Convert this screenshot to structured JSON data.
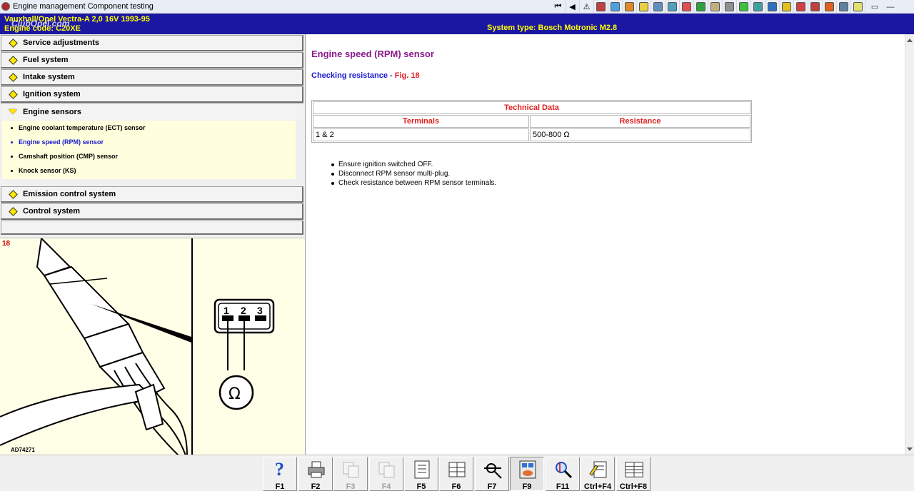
{
  "window": {
    "title": "Engine management Component testing"
  },
  "toolbar_icons": [
    {
      "name": "first-page-icon",
      "glyph": "⏮"
    },
    {
      "name": "previous-icon",
      "glyph": "◀"
    },
    {
      "name": "warning-icon",
      "glyph": "⚠"
    },
    {
      "name": "wiring-icon",
      "color": "#c04040"
    },
    {
      "name": "diagram-icon",
      "color": "#4aa0e0"
    },
    {
      "name": "engine-icon",
      "color": "#e08a2a"
    },
    {
      "name": "camera-icon",
      "color": "#e8d040"
    },
    {
      "name": "wheel-icon",
      "color": "#6090c0"
    },
    {
      "name": "tools-icon",
      "color": "#50a0c0"
    },
    {
      "name": "battery-icon",
      "color": "#e05050"
    },
    {
      "name": "exit-icon",
      "color": "#30a040"
    },
    {
      "name": "brush-icon",
      "color": "#c0b080"
    },
    {
      "name": "spray-icon",
      "color": "#909090"
    },
    {
      "name": "parts-icon",
      "color": "#40c040"
    },
    {
      "name": "gauge-icon",
      "color": "#40a0a0"
    },
    {
      "name": "car-icon",
      "color": "#3070c0"
    },
    {
      "name": "book-icon",
      "color": "#e0c020"
    },
    {
      "name": "doc-icon",
      "color": "#d04040"
    },
    {
      "name": "service-icon",
      "color": "#c04040"
    },
    {
      "name": "alert-icon",
      "color": "#e06020"
    },
    {
      "name": "vehicle-icon",
      "color": "#6080a0"
    },
    {
      "name": "notes-icon",
      "color": "#e0e070"
    }
  ],
  "window_controls": {
    "minimize": "▭",
    "maximize": "—"
  },
  "infobar": {
    "vehicle": "Vauxhall/Opel   Vectra-A  2,0 16V 1993-95",
    "engine": "Engine code: C20XE",
    "system_type": "System type: Bosch Motronic M2.8",
    "watermark": "ClubOpel.com"
  },
  "nav": {
    "sections": [
      {
        "label": "Service adjustments"
      },
      {
        "label": "Fuel system"
      },
      {
        "label": "Intake system"
      },
      {
        "label": "Ignition system"
      }
    ],
    "open_section": {
      "label": "Engine sensors",
      "items": [
        {
          "label": "Engine coolant temperature (ECT) sensor"
        },
        {
          "label": "Engine speed (RPM) sensor"
        },
        {
          "label": "Camshaft position (CMP) sensor"
        },
        {
          "label": "Knock sensor (KS)"
        }
      ]
    },
    "lower_sections": [
      {
        "label": "Emission control system"
      },
      {
        "label": "Control system"
      }
    ]
  },
  "figure": {
    "number": "18",
    "code": "AD74271",
    "pins": [
      "1",
      "2",
      "3"
    ],
    "meter_symbol": "Ω"
  },
  "content": {
    "title": "Engine speed (RPM) sensor",
    "check_label": "Checking resistance",
    "check_sep": " - ",
    "check_fig": "Fig. 18",
    "table": {
      "caption": "Technical Data",
      "headers": [
        "Terminals",
        "Resistance"
      ],
      "rows": [
        [
          "1 & 2",
          "500-800 Ω"
        ]
      ]
    },
    "steps": [
      "Ensure ignition switched OFF.",
      "Disconnect RPM sensor multi-plug.",
      "Check resistance between RPM sensor terminals."
    ]
  },
  "function_keys": [
    {
      "label": "F1",
      "icon": "help-icon",
      "enabled": true
    },
    {
      "label": "F2",
      "icon": "print-icon",
      "enabled": true
    },
    {
      "label": "F3",
      "icon": "copy-icon",
      "enabled": false
    },
    {
      "label": "F4",
      "icon": "paste-icon",
      "enabled": false
    },
    {
      "label": "F5",
      "icon": "document-icon",
      "enabled": true
    },
    {
      "label": "F6",
      "icon": "table-icon",
      "enabled": true
    },
    {
      "label": "F7",
      "icon": "wiring-probe-icon",
      "enabled": true
    },
    {
      "label": "F9",
      "icon": "connector-icon",
      "enabled": true,
      "pressed": true
    },
    {
      "label": "F11",
      "icon": "search-doc-icon",
      "enabled": true
    },
    {
      "label": "Ctrl+F4",
      "icon": "notes-edit-icon",
      "enabled": true
    },
    {
      "label": "Ctrl+F8",
      "icon": "list-icon",
      "enabled": true
    }
  ]
}
